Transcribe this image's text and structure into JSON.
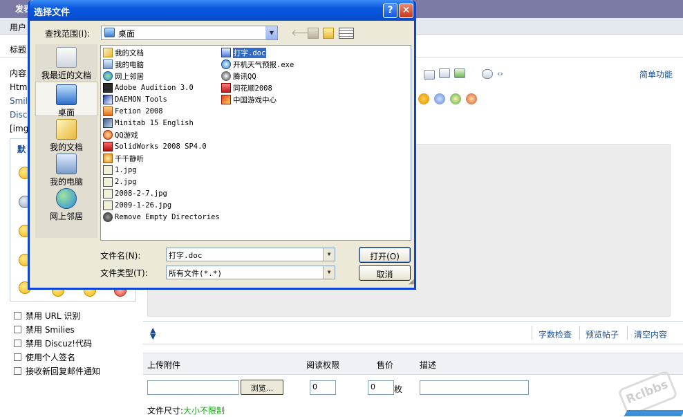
{
  "background": {
    "title_fragment": "发表",
    "row_user": "用户",
    "row_title": "标题",
    "row_content": "内容",
    "left_lines": [
      "Html",
      "Smil",
      "Disc",
      "[img]"
    ],
    "smiley_header": "默",
    "simple_link": "简单功能",
    "editor_buttons": [
      "字数检查",
      "预览帖子",
      "清空内容"
    ],
    "options": [
      "禁用 URL 识别",
      "禁用 Smilies",
      "禁用 Discuz!代码",
      "使用个人签名",
      "接收新回复邮件通知"
    ],
    "upload": {
      "headers": {
        "attachment": "上传附件",
        "permission": "阅读权限",
        "price": "售价",
        "description": "描述"
      },
      "browse_label": "浏览...",
      "permission_value": "0",
      "price_value": "0",
      "price_unit": "枚",
      "filesize_label": "文件尺寸:",
      "filesize_value": "大小不限制"
    },
    "watermark": "Rclbbs"
  },
  "dialog": {
    "title": "选择文件",
    "lookin_label": "查找范围(I):",
    "lookin_value": "桌面",
    "places": [
      {
        "label": "我最近的文档",
        "icon": "recent-documents-icon"
      },
      {
        "label": "桌面",
        "icon": "desktop-icon"
      },
      {
        "label": "我的文档",
        "icon": "my-documents-icon"
      },
      {
        "label": "我的电脑",
        "icon": "my-computer-icon"
      },
      {
        "label": "网上邻居",
        "icon": "network-places-icon"
      }
    ],
    "files_col1": [
      {
        "name": "我的文档",
        "icon": "folder-icon"
      },
      {
        "name": "我的电脑",
        "icon": "computer-icon"
      },
      {
        "name": "网上邻居",
        "icon": "network-icon"
      },
      {
        "name": "Adobe Audition 3.0",
        "icon": "shortcut-icon"
      },
      {
        "name": "DAEMON Tools",
        "icon": "shortcut-icon"
      },
      {
        "name": "Fetion 2008",
        "icon": "shortcut-icon"
      },
      {
        "name": "Minitab 15 English",
        "icon": "shortcut-icon"
      },
      {
        "name": "QQ游戏",
        "icon": "shortcut-icon"
      },
      {
        "name": "SolidWorks 2008 SP4.0",
        "icon": "shortcut-icon"
      },
      {
        "name": "千千静听",
        "icon": "shortcut-icon"
      },
      {
        "name": "1.jpg",
        "icon": "jpg-file-icon"
      },
      {
        "name": "2.jpg",
        "icon": "jpg-file-icon"
      },
      {
        "name": "2008-2-7.jpg",
        "icon": "jpg-file-icon"
      },
      {
        "name": "2009-1-26.jpg",
        "icon": "jpg-file-icon"
      },
      {
        "name": "Remove Empty Directories",
        "icon": "shortcut-icon"
      }
    ],
    "files_col2": [
      {
        "name": "打字.doc",
        "icon": "doc-file-icon",
        "selected": true
      },
      {
        "name": "开机天气预报.exe",
        "icon": "exe-file-icon"
      },
      {
        "name": "腾讯QQ",
        "icon": "shortcut-icon"
      },
      {
        "name": "同花顺2008",
        "icon": "shortcut-icon"
      },
      {
        "name": "中国游戏中心",
        "icon": "shortcut-icon"
      }
    ],
    "filename_label": "文件名(N):",
    "filename_value": "打字.doc",
    "filetype_label": "文件类型(T):",
    "filetype_value": "所有文件(*.*)",
    "open_label": "打开(O)",
    "cancel_label": "取消",
    "help_label": "?",
    "close_label": "✕"
  }
}
